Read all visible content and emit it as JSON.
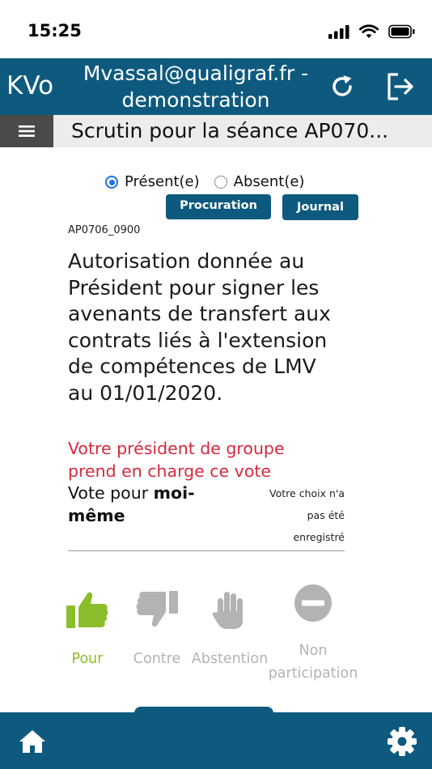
{
  "status_bar": {
    "time": "15:25"
  },
  "header": {
    "brand": "KVo",
    "account_line1": "Mvassal@qualigraf.fr -",
    "account_line2": "demonstration"
  },
  "title_bar": {
    "title": "Scrutin pour la séance AP070..."
  },
  "presence": {
    "present_label": "Présent(e)",
    "absent_label": "Absent(e)",
    "selected": "present"
  },
  "actions": {
    "procuration_label": "Procuration",
    "journal_label": "Journal"
  },
  "motion": {
    "code": "AP0706_0900",
    "question": "Autorisation donnée au Président pour signer les avenants de transfert aux contrats liés à l'extension de compétences de LMV au 01/01/2020.",
    "delegate_notice": "Votre président de groupe prend en charge ce vote",
    "vote_for_prefix": "Vote pour ",
    "vote_for_bold": "moi-même",
    "not_recorded": "Votre choix n'a pas été enregistré"
  },
  "vote_options": [
    {
      "label": "Pour",
      "icon": "thumbs-up-icon",
      "color": "#8cbd2a"
    },
    {
      "label": "Contre",
      "icon": "thumbs-down-icon",
      "color": "#b3b3b3"
    },
    {
      "label": "Abstention",
      "icon": "raised-hand-icon",
      "color": "#b3b3b3"
    },
    {
      "label": "Non participation",
      "icon": "no-entry-icon",
      "color": "#b3b3b3"
    }
  ],
  "colors": {
    "primary": "#0e5a7f",
    "alert": "#d8283c",
    "accent": "#8cbd2a",
    "muted": "#b3b3b3"
  },
  "bottom_nav": {
    "left_icon": "home-icon",
    "right_icon": "gear-icon"
  }
}
